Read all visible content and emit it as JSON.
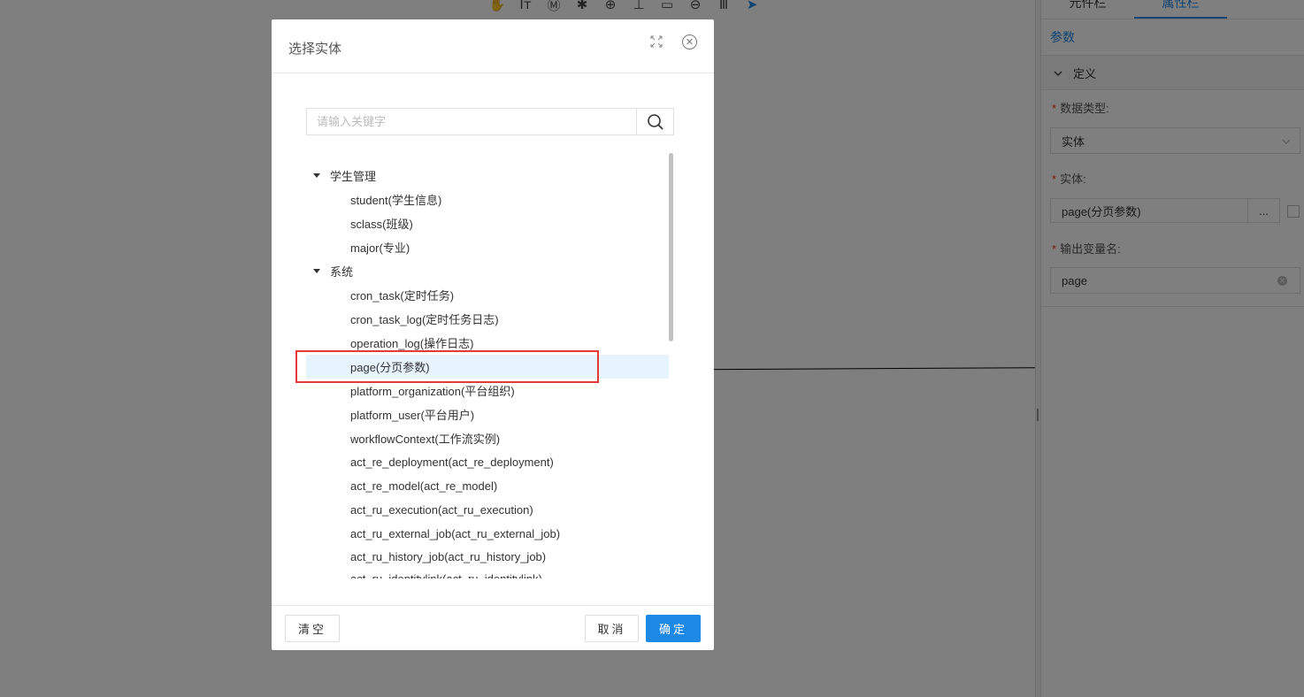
{
  "toolbar": {
    "icons": [
      "hand-icon",
      "text-size-icon",
      "m-circle-icon",
      "bug-icon",
      "zoom-in-icon",
      "align-icon",
      "page-icon",
      "zoom-out-icon",
      "columns-icon",
      "send-icon"
    ]
  },
  "right_panel": {
    "tabs": [
      "元件栏",
      "属性栏"
    ],
    "params_label": "参数",
    "section_title": "定义",
    "data_type_label": "数据类型:",
    "data_type_value": "实体",
    "entity_label": "实体:",
    "entity_value": "page(分页参数)",
    "entity_dots": "...",
    "output_label": "输出变量名:",
    "output_value": "page",
    "required_mark": "*"
  },
  "modal": {
    "title": "选择实体",
    "search_placeholder": "请输入关键字",
    "tree": [
      {
        "label": "学生管理",
        "type": "group"
      },
      {
        "label": "student(学生信息)",
        "type": "leaf"
      },
      {
        "label": "sclass(班级)",
        "type": "leaf"
      },
      {
        "label": "major(专业)",
        "type": "leaf"
      },
      {
        "label": "系统",
        "type": "group"
      },
      {
        "label": "cron_task(定时任务)",
        "type": "leaf"
      },
      {
        "label": "cron_task_log(定时任务日志)",
        "type": "leaf"
      },
      {
        "label": "operation_log(操作日志)",
        "type": "leaf"
      },
      {
        "label": "page(分页参数)",
        "type": "leaf",
        "selected": true
      },
      {
        "label": "platform_organization(平台组织)",
        "type": "leaf"
      },
      {
        "label": "platform_user(平台用户)",
        "type": "leaf"
      },
      {
        "label": "workflowContext(工作流实例)",
        "type": "leaf"
      },
      {
        "label": "act_re_deployment(act_re_deployment)",
        "type": "leaf"
      },
      {
        "label": "act_re_model(act_re_model)",
        "type": "leaf"
      },
      {
        "label": "act_ru_execution(act_ru_execution)",
        "type": "leaf"
      },
      {
        "label": "act_ru_external_job(act_ru_external_job)",
        "type": "leaf"
      },
      {
        "label": "act_ru_history_job(act_ru_history_job)",
        "type": "leaf"
      },
      {
        "label": "act_ru_identitylink(act_ru_identitylink)",
        "type": "leaf"
      }
    ],
    "buttons": {
      "clear": "清空",
      "cancel": "取消",
      "ok": "确定"
    }
  },
  "colors": {
    "primary": "#1e88e5",
    "highlight_border": "#e53935",
    "selected_row": "#e8f4fd"
  }
}
